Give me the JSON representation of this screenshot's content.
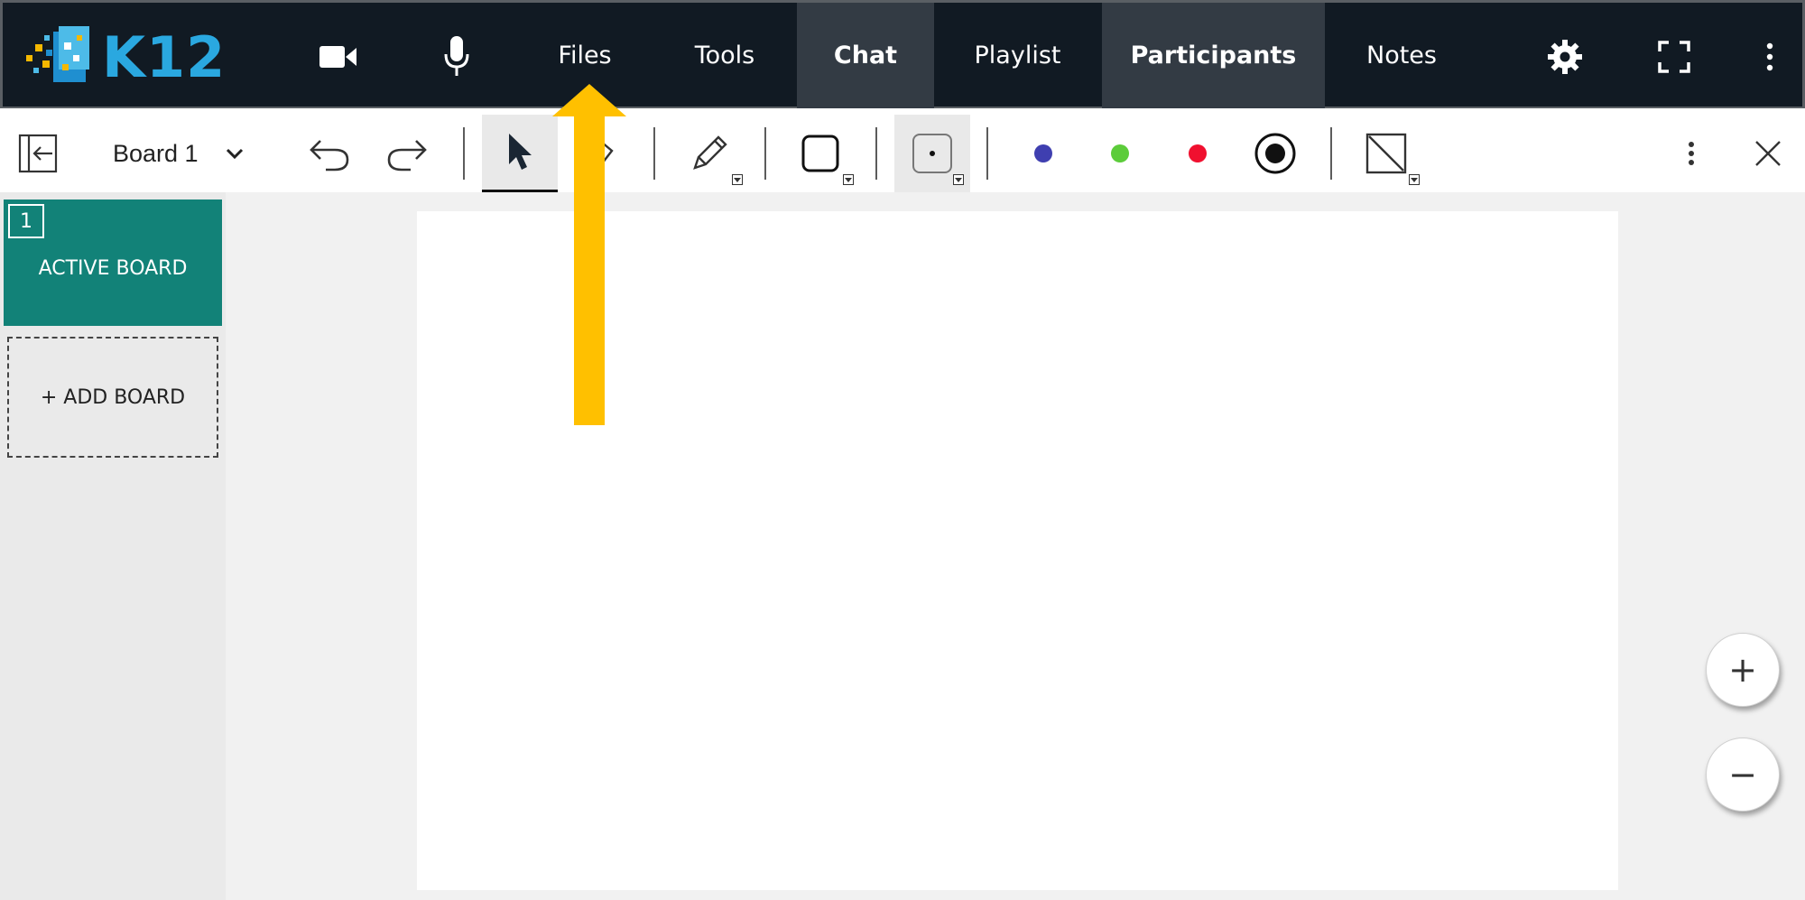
{
  "app": {
    "logo_text": "K12"
  },
  "nav": {
    "icons": [
      "video-camera-icon",
      "microphone-icon",
      "gear-icon",
      "fullscreen-icon",
      "more-vertical-icon"
    ],
    "tabs": [
      {
        "label": "Files",
        "active": false
      },
      {
        "label": "Tools",
        "active": false
      },
      {
        "label": "Chat",
        "active": true
      },
      {
        "label": "Playlist",
        "active": false
      },
      {
        "label": "Participants",
        "active": true
      },
      {
        "label": "Notes",
        "active": false
      }
    ]
  },
  "toolbar": {
    "board_name": "Board 1",
    "tools": [
      "collapse-panel-icon",
      "undo-icon",
      "redo-icon",
      "select-pointer-icon",
      "eraser-icon",
      "pencil-icon",
      "rectangle-icon",
      "dot-size-icon",
      "line-icon",
      "more-vertical-icon",
      "close-icon"
    ],
    "selected_tool": "select-pointer-icon",
    "colors": [
      "#3f3fb0",
      "#5ccc3a",
      "#f0102f",
      "#111111"
    ],
    "selected_color": "#111111"
  },
  "boards": {
    "items": [
      {
        "number": "1",
        "label": "ACTIVE BOARD"
      }
    ],
    "add_label": "+ ADD BOARD"
  },
  "zoom": {
    "in_label": "+",
    "out_label": "−"
  },
  "annotation": {
    "arrow_color": "#ffc000"
  }
}
